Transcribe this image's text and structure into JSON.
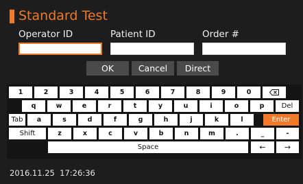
{
  "title": "Standard Test",
  "form": {
    "operator_label": "Operator ID",
    "patient_label": "Patient ID",
    "order_label": "Order #",
    "operator_value": "",
    "patient_value": "",
    "order_value": ""
  },
  "actions": {
    "ok": "OK",
    "cancel": "Cancel",
    "direct": "Direct"
  },
  "keyboard": {
    "row1": [
      "1",
      "2",
      "3",
      "4",
      "5",
      "6",
      "7",
      "8",
      "9",
      "0"
    ],
    "backspace_icon": "backspace-icon",
    "row2": [
      "q",
      "w",
      "e",
      "r",
      "t",
      "y",
      "u",
      "i",
      "o",
      "p"
    ],
    "del": "Del",
    "tab": "Tab",
    "row3": [
      "a",
      "s",
      "d",
      "f",
      "g",
      "h",
      "j",
      "k",
      "l"
    ],
    "enter": "Enter",
    "shift": "Shift",
    "row4": [
      "z",
      "x",
      "c",
      "v",
      "b",
      "n",
      "m",
      ".",
      "_",
      "-"
    ],
    "space": "Space",
    "left_arrow": "←",
    "right_arrow": "→"
  },
  "status": {
    "date": "2016.11.25",
    "time": "17:26:36"
  },
  "colors": {
    "accent": "#f07a2a",
    "background": "#1d1d1d"
  }
}
